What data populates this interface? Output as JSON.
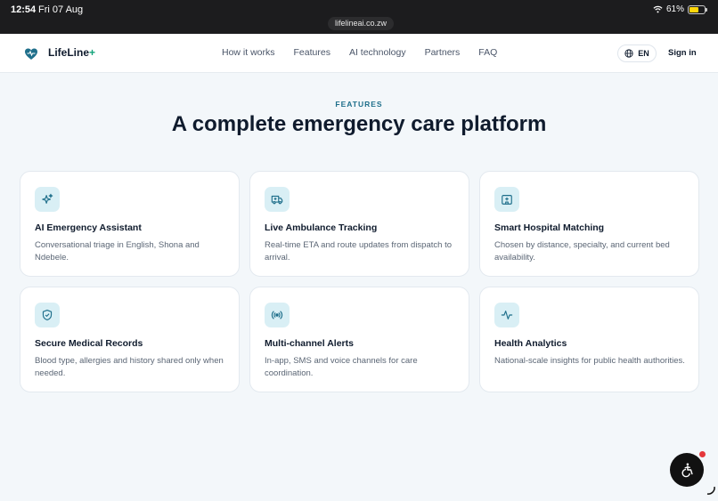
{
  "status_bar": {
    "time": "12:54",
    "date": "Fri 07 Aug",
    "url": "lifelineai.co.zw",
    "battery_percent": "61%",
    "battery_level": 0.61
  },
  "nav": {
    "brand_main": "LifeLine",
    "brand_plus": "+",
    "links": [
      "How it works",
      "Features",
      "AI technology",
      "Partners",
      "FAQ"
    ],
    "lang": "EN",
    "signin": "Sign in"
  },
  "section": {
    "eyebrow": "FEATURES",
    "title": "A complete emergency care platform"
  },
  "features": [
    {
      "icon": "sparkle-icon",
      "title": "AI Emergency Assistant",
      "desc": "Conversational triage in English, Shona and Ndebele."
    },
    {
      "icon": "ambulance-icon",
      "title": "Live Ambulance Tracking",
      "desc": "Real-time ETA and route updates from dispatch to arrival."
    },
    {
      "icon": "hospital-icon",
      "title": "Smart Hospital Matching",
      "desc": "Chosen by distance, specialty, and current bed availability."
    },
    {
      "icon": "shield-check-icon",
      "title": "Secure Medical Records",
      "desc": "Blood type, allergies and history shared only when needed."
    },
    {
      "icon": "broadcast-icon",
      "title": "Multi-channel Alerts",
      "desc": "In-app, SMS and voice channels for care coordination."
    },
    {
      "icon": "activity-icon",
      "title": "Health Analytics",
      "desc": "National-scale insights for public health authorities."
    }
  ],
  "colors": {
    "accent": "#1f6f8b",
    "icon_bg": "#d9eff5",
    "brand_plus": "#12a37a",
    "badge": "#e5383b"
  }
}
